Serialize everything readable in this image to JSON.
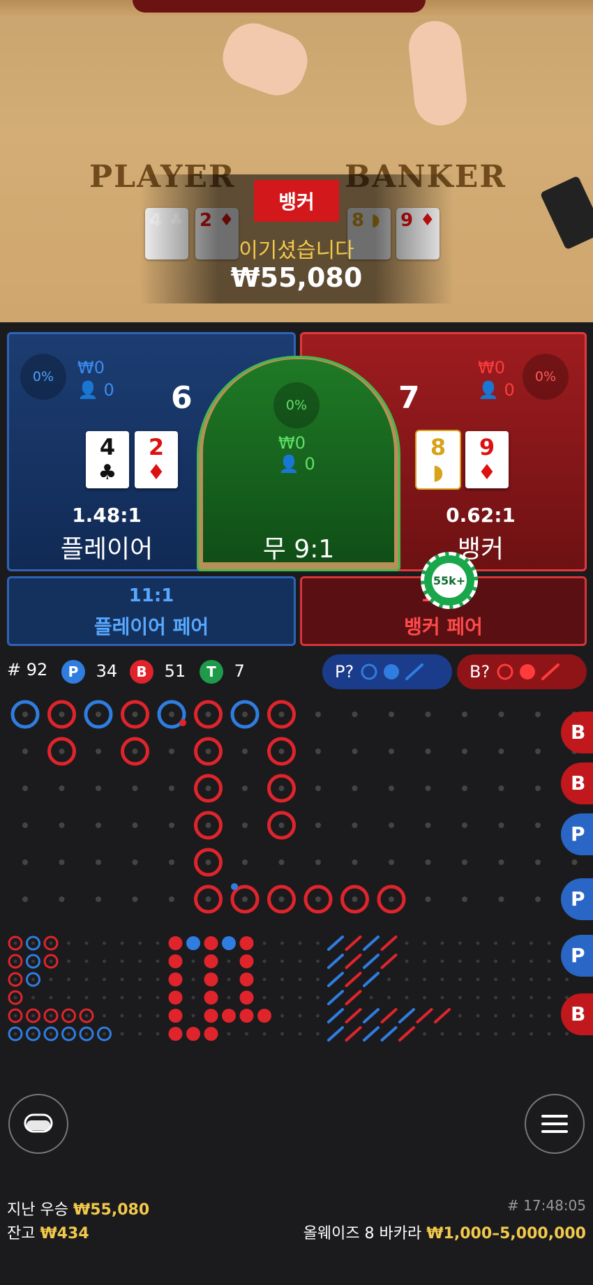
{
  "video": {
    "table_player": "PLAYER",
    "table_banker": "BANKER",
    "player_cards": [
      {
        "v": "4",
        "s": "♣",
        "c": "#111"
      },
      {
        "v": "2",
        "s": "♦",
        "c": "#d11"
      }
    ],
    "banker_cards": [
      {
        "v": "8",
        "s": "◗",
        "c": "#d9a21b"
      },
      {
        "v": "9",
        "s": "♦",
        "c": "#d11"
      }
    ],
    "winner_label": "뱅커",
    "win_message": "이기셨습니다",
    "win_amount": "₩55,080"
  },
  "player": {
    "percent": "0%",
    "bet_amount": "₩0",
    "bettors": "0",
    "score": "6",
    "cards": [
      {
        "v": "4",
        "s": "♣",
        "c": "#111"
      },
      {
        "v": "2",
        "s": "♦",
        "c": "#d11"
      }
    ],
    "payout": "1.48:1",
    "label": "플레이어"
  },
  "tie": {
    "percent": "0%",
    "bet_amount": "₩0",
    "bettors": "0",
    "label": "무 9:1"
  },
  "banker": {
    "percent": "0%",
    "bet_amount": "₩0",
    "bettors": "0",
    "score": "7",
    "cards": [
      {
        "v": "8",
        "s": "◗",
        "c": "#d9a21b"
      },
      {
        "v": "9",
        "s": "♦",
        "c": "#d11"
      }
    ],
    "payout": "0.62:1",
    "label": "뱅커"
  },
  "player_pair": {
    "payout": "11:1",
    "label": "플레이어 페어"
  },
  "banker_pair": {
    "payout": "11:1",
    "label": "뱅커 페어",
    "chip": "55k+"
  },
  "stats": {
    "round": "# 92",
    "p_badge": "P",
    "p_count": "34",
    "b_badge": "B",
    "b_count": "51",
    "t_badge": "T",
    "t_count": "7"
  },
  "predict": {
    "player": "P?",
    "banker": "B?"
  },
  "colors": {
    "player": "#2f7de1",
    "banker": "#e0242c",
    "tie": "#1f9a4a",
    "gold": "#f2c94c"
  },
  "side_buttons": [
    "B",
    "B",
    "P",
    "P",
    "P",
    "B"
  ],
  "footer": {
    "last_win_label": "지난 우승",
    "last_win_value": "₩55,080",
    "balance_label": "잔고",
    "balance_value": "₩434",
    "time": "# 17:48:05",
    "table_name": "올웨이즈 8 바카라",
    "limits": "₩1,000–5,000,000"
  },
  "icons": {
    "left_button": "chat-bubble-icon",
    "right_button": "menu-icon"
  }
}
